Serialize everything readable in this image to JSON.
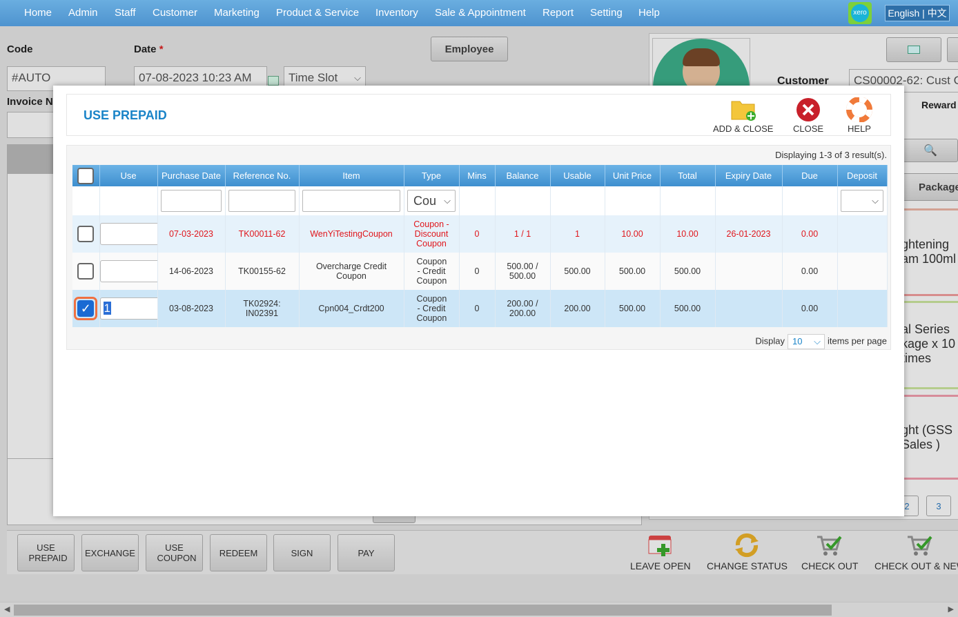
{
  "nav": {
    "items": [
      "Home",
      "Admin",
      "Staff",
      "Customer",
      "Marketing",
      "Product & Service",
      "Inventory",
      "Sale & Appointment",
      "Report",
      "Setting",
      "Help"
    ],
    "xero": "xero",
    "language": "English | 中文"
  },
  "form": {
    "code_label": "Code",
    "code_value": "#AUTO",
    "date_label": "Date",
    "date_required": "*",
    "date_value": "07-08-2023 10:23 AM",
    "time_slot": "Time Slot",
    "invoice_label": "Invoice N",
    "employee_button": "Employee",
    "customer_label": "Customer",
    "customer_value": "CS00002-62: Cust C",
    "reward_label": "Reward",
    "package_tab": "Package"
  },
  "background_items": [
    {
      "lines": [
        "ghtening",
        "am 100ml"
      ]
    },
    {
      "lines": [
        "al Series",
        "kage x 10",
        "times"
      ]
    },
    {
      "lines": [
        "ght (GSS",
        "Sales )"
      ]
    }
  ],
  "pages": [
    "2",
    "3"
  ],
  "bottom_buttons": [
    "USE PREPAID",
    "EXCHANGE",
    "USE COUPON",
    "REDEEM",
    "SIGN",
    "PAY"
  ],
  "actions": [
    "LEAVE OPEN",
    "CHANGE STATUS",
    "CHECK OUT",
    "CHECK OUT & NEW"
  ],
  "modal": {
    "title": "USE PREPAID",
    "tools": {
      "add_close": "ADD & CLOSE",
      "close": "CLOSE",
      "help": "HELP"
    },
    "displaying": "Displaying 1-3 of 3 result(s).",
    "columns": [
      "Use",
      "Purchase Date",
      "Reference No.",
      "Item",
      "Type",
      "Mins",
      "Balance",
      "Usable",
      "Unit Price",
      "Total",
      "Expiry Date",
      "Due",
      "Deposit"
    ],
    "type_filter": "Cou",
    "rows": [
      {
        "checked": false,
        "use": "",
        "purchase_date": "07-03-2023",
        "reference": "TK00011-62",
        "item": "WenYiTestingCoupon",
        "type": "Coupon - Discount Coupon",
        "mins": "0",
        "balance": "1 / 1",
        "usable": "1",
        "unit_price": "10.00",
        "total": "10.00",
        "expiry": "26-01-2023",
        "due": "0.00",
        "deposit": ""
      },
      {
        "checked": false,
        "use": "",
        "purchase_date": "14-06-2023",
        "reference": "TK00155-62",
        "item": "Overcharge Credit Coupon",
        "type": "Coupon - Credit Coupon",
        "mins": "0",
        "balance": "500.00 / 500.00",
        "usable": "500.00",
        "unit_price": "500.00",
        "total": "500.00",
        "expiry": "",
        "due": "0.00",
        "deposit": ""
      },
      {
        "checked": true,
        "use": "1",
        "purchase_date": "03-08-2023",
        "reference": "TK02924: IN02391",
        "item": "Cpn004_Crdt200",
        "type": "Coupon - Credit Coupon",
        "mins": "0",
        "balance": "200.00 / 200.00",
        "usable": "200.00",
        "unit_price": "500.00",
        "total": "500.00",
        "expiry": "",
        "due": "0.00",
        "deposit": ""
      }
    ],
    "pager": {
      "display": "Display",
      "per_page": "10",
      "items_label": "items per page"
    }
  }
}
